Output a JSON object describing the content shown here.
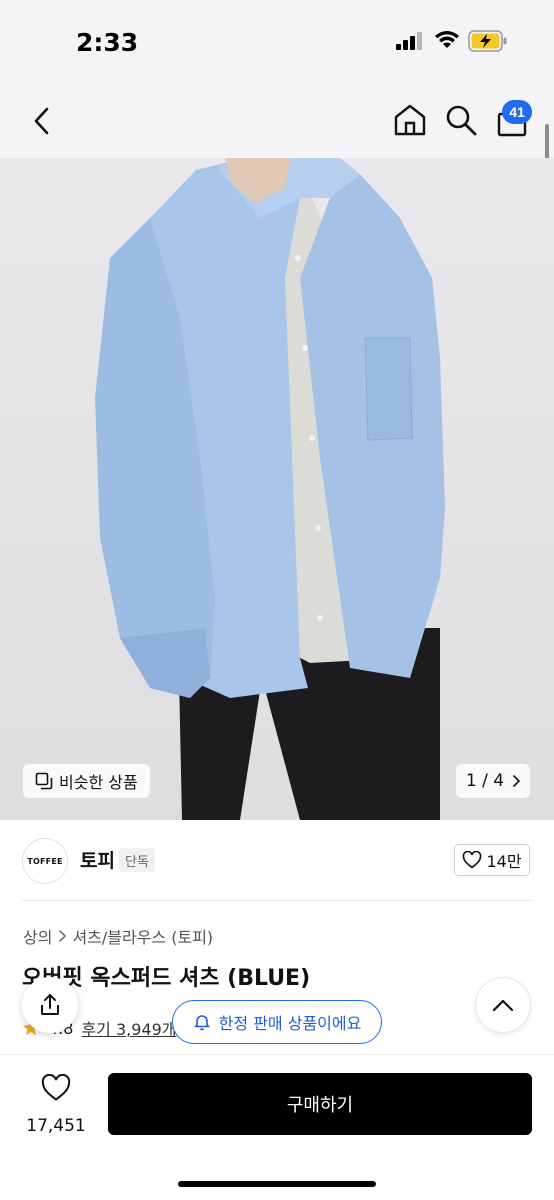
{
  "status_bar": {
    "time": "2:33"
  },
  "nav": {
    "cart_count": "41"
  },
  "image": {
    "similar_label": "비슷한 상품",
    "counter": "1 / 4"
  },
  "brand": {
    "logo_text": "TOFFEE",
    "name": "토피",
    "badge": "단독",
    "likes": "14만"
  },
  "breadcrumb": {
    "category": "상의",
    "sub_category": "셔츠/블라우스 (토피)"
  },
  "product": {
    "title": "오버핏 옥스퍼드 셔츠 (BLUE)",
    "rating": "4.8",
    "reviews": "후기 3,949개"
  },
  "limited_pill": {
    "label": "한정 판매 상품이에요"
  },
  "bottom": {
    "wish_count": "17,451",
    "buy_label": "구매하기"
  },
  "colors": {
    "accent": "#1f6cf0",
    "shirt": "#a9c6ea",
    "pants": "#1c1c1e",
    "tee": "#dcdcd6"
  }
}
